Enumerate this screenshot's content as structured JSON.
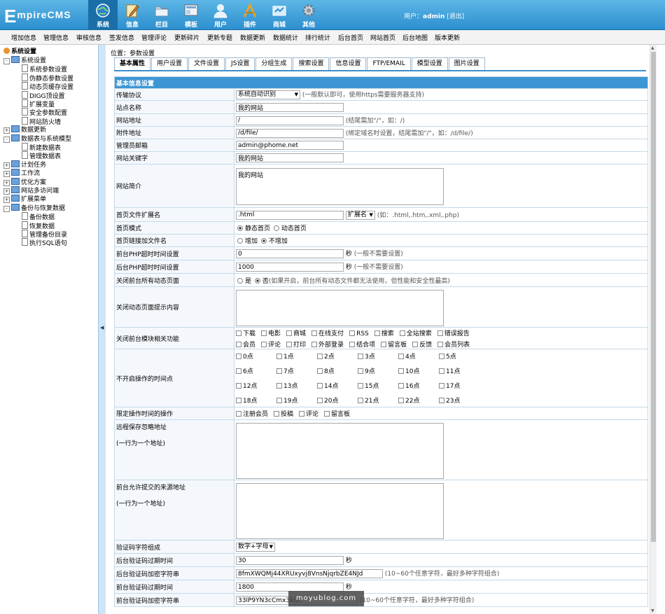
{
  "header": {
    "logo": "EmpireCMS",
    "nav": [
      {
        "label": "系统",
        "icon": "globe-icon",
        "active": true
      },
      {
        "label": "信息",
        "icon": "pencil-note-icon"
      },
      {
        "label": "栏目",
        "icon": "folder-icon"
      },
      {
        "label": "模板",
        "icon": "template-icon"
      },
      {
        "label": "用户",
        "icon": "user-icon"
      },
      {
        "label": "插件",
        "icon": "tools-icon"
      },
      {
        "label": "商城",
        "icon": "shop-icon"
      },
      {
        "label": "其他",
        "icon": "gear-icon"
      }
    ],
    "user_prefix": "用户：",
    "user_name": "admin",
    "logout": "[退出]"
  },
  "menubar": [
    "增加信息",
    "管理信息",
    "审核信息",
    "签发信息",
    "管理评论",
    "更新碎片",
    "更新专题",
    "数据更新",
    "数据统计",
    "排行统计",
    "后台首页",
    "网站首页",
    "后台地图",
    "版本更新"
  ],
  "sidebar": {
    "root": "系统设置",
    "items": [
      {
        "label": "系统设置",
        "level": 1,
        "type": "folder",
        "pm": "-"
      },
      {
        "label": "系统参数设置",
        "level": 2,
        "type": "doc"
      },
      {
        "label": "伪静态参数设置",
        "level": 2,
        "type": "doc"
      },
      {
        "label": "动态页缓存设置",
        "level": 2,
        "type": "doc"
      },
      {
        "label": "DIGG顶设置",
        "level": 2,
        "type": "doc"
      },
      {
        "label": "扩展变量",
        "level": 2,
        "type": "doc"
      },
      {
        "label": "安全参数配置",
        "level": 2,
        "type": "doc"
      },
      {
        "label": "网站防火墙",
        "level": 2,
        "type": "doc"
      },
      {
        "label": "数据更新",
        "level": 1,
        "type": "folder",
        "pm": "+"
      },
      {
        "label": "数据表与系统模型",
        "level": 1,
        "type": "folder",
        "pm": "-"
      },
      {
        "label": "新建数据表",
        "level": 2,
        "type": "doc"
      },
      {
        "label": "管理数据表",
        "level": 2,
        "type": "doc"
      },
      {
        "label": "计划任务",
        "level": 1,
        "type": "folder",
        "pm": "+"
      },
      {
        "label": "工作流",
        "level": 1,
        "type": "folder",
        "pm": "+"
      },
      {
        "label": "优化方案",
        "level": 1,
        "type": "folder",
        "pm": "+"
      },
      {
        "label": "网站多访问端",
        "level": 1,
        "type": "folder",
        "pm": "+"
      },
      {
        "label": "扩展菜单",
        "level": 1,
        "type": "folder",
        "pm": "+"
      },
      {
        "label": "备份与恢复数据",
        "level": 1,
        "type": "folder",
        "pm": "-"
      },
      {
        "label": "备份数据",
        "level": 2,
        "type": "doc"
      },
      {
        "label": "恢复数据",
        "level": 2,
        "type": "doc"
      },
      {
        "label": "管理备份目录",
        "level": 2,
        "type": "doc"
      },
      {
        "label": "执行SQL语句",
        "level": 2,
        "type": "doc"
      }
    ]
  },
  "breadcrumb": {
    "prefix": "位置：",
    "link": "参数设置"
  },
  "tabs": [
    "基本属性",
    "用户设置",
    "文件设置",
    "JS设置",
    "分组生成",
    "搜索设置",
    "信息设置",
    "FTP/EMAIL",
    "模型设置",
    "图片设置"
  ],
  "section_title": "基本信息设置",
  "fields": {
    "protocol": {
      "label": "传输协议",
      "value": "系统自动识别",
      "hint": "(一般默认即可，使用https需要服务器支持)"
    },
    "sitename": {
      "label": "站点名称",
      "value": "我的网站"
    },
    "siteurl": {
      "label": "网站地址",
      "value": "/",
      "hint": "(结尾需加\"/\"，如：/)"
    },
    "fileurl": {
      "label": "附件地址",
      "value": "/d/file/",
      "hint": "(绑定域名时设置，结尾需加\"/\"，如：/d/file/)"
    },
    "email": {
      "label": "管理员邮箱",
      "value": "admin@phome.net"
    },
    "keywords": {
      "label": "网站关键字",
      "value": "我的网站"
    },
    "intro": {
      "label": "网站简介",
      "value": "我的网站"
    },
    "indexext": {
      "label": "首页文件扩展名",
      "value": ".html",
      "select": "扩展名",
      "hint": "(如：.html,.htm,.xml,.php)"
    },
    "indexmode": {
      "label": "首页模式",
      "opt1": "静态首页",
      "opt2": "动态首页"
    },
    "indexlinkfile": {
      "label": "首页链接加文件名",
      "opt1": "增加",
      "opt2": "不增加"
    },
    "phptimeout": {
      "label": "前台PHP超时时间设置",
      "value": "0",
      "unit": "秒",
      "hint": "(一般不需要设置)"
    },
    "adminphptimeout": {
      "label": "后台PHP超时时间设置",
      "value": "1000",
      "unit": "秒",
      "hint": "(一般不需要设置)"
    },
    "closedynamic": {
      "label": "关闭前台所有动态页面",
      "opt1": "是",
      "opt2": "否",
      "hint": "(如果开启，前台所有动态文件都无法使用，但性能和安全性最高)"
    },
    "closedynamicmsg": {
      "label": "关闭动态页面提示内容"
    },
    "closemodules": {
      "label": "关闭前台模块相关功能",
      "row1": [
        "下载",
        "电影",
        "商城",
        "在线支付",
        "RSS",
        "搜索",
        "全站搜索",
        "错误报告"
      ],
      "row2": [
        "会员",
        "评论",
        "打印",
        "外部登录",
        "结合项",
        "留言板",
        "反馈",
        "会员列表"
      ]
    },
    "closehours": {
      "label": "不开启操作的时间点",
      "hours": [
        "0点",
        "1点",
        "2点",
        "3点",
        "4点",
        "5点",
        "6点",
        "7点",
        "8点",
        "9点",
        "10点",
        "11点",
        "12点",
        "13点",
        "14点",
        "15点",
        "16点",
        "17点",
        "18点",
        "19点",
        "20点",
        "21点",
        "22点",
        "23点"
      ]
    },
    "limitops": {
      "label": "限定操作时间的操作",
      "opts": [
        "注册会员",
        "投稿",
        "评论",
        "留言板"
      ]
    },
    "remoteignore": {
      "label": "远程保存忽略地址",
      "sub": "(一行为一个地址)"
    },
    "allowsource": {
      "label": "前台允许提交的来源地址",
      "sub": "(一行为一个地址)"
    },
    "keychars": {
      "label": "验证码字符组成",
      "value": "数字+字母"
    },
    "adminkeytime": {
      "label": "后台验证码过期时间",
      "value": "30",
      "unit": "秒"
    },
    "adminkeyrnd": {
      "label": "后台验证码加密字符串",
      "value": "8fmXWQMj44XRUxyvj8VnsNjqrbZE4NJd",
      "hint": "(10~60个任意字符，最好多种字符组合)"
    },
    "keytime": {
      "label": "前台验证码过期时间",
      "value": "1800",
      "unit": "秒"
    },
    "keyrnd": {
      "label": "前台验证码加密字符串",
      "value": "33lP9YN3cCmx3kQc",
      "hint": "(10~60个任意字符，最好多种字符组合)"
    }
  },
  "watermark": "moyublog.com",
  "colors": {
    "header": "#2c8fcf",
    "section": "#3d96d4",
    "border": "#c5d9e8"
  }
}
